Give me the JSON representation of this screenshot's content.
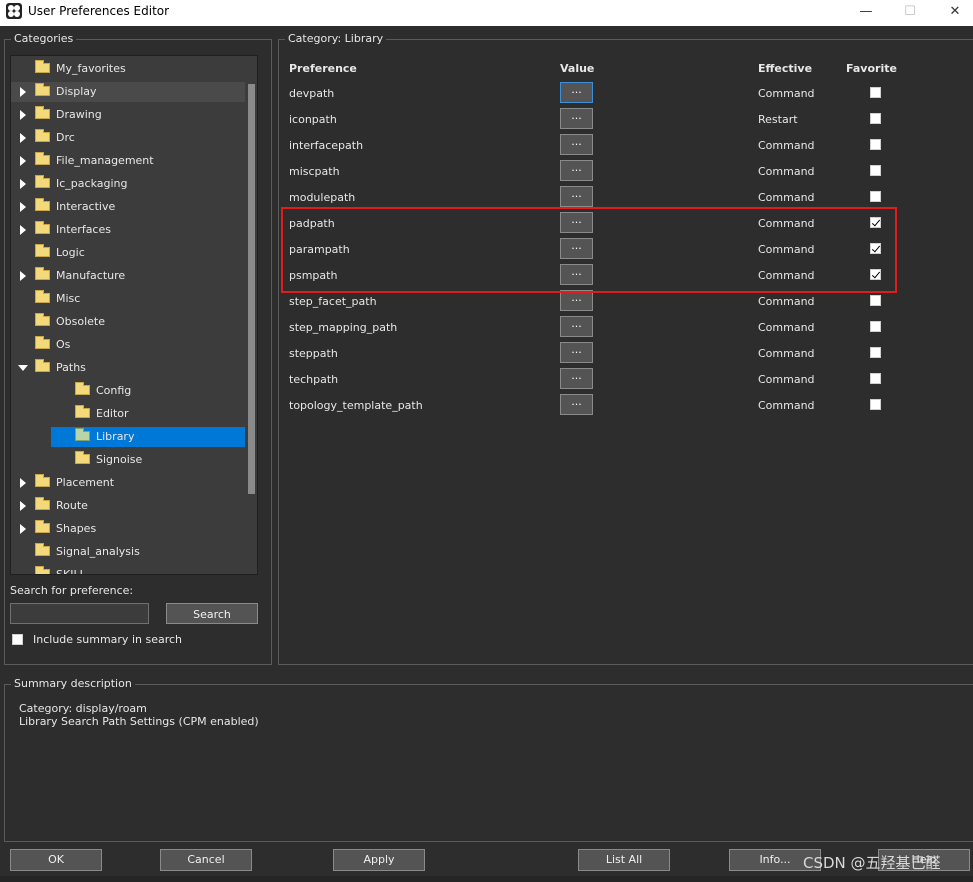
{
  "window": {
    "title": "User Preferences Editor",
    "minimize": "—",
    "maximize": "☐",
    "close": "✕"
  },
  "categories": {
    "legend": "Categories",
    "items": [
      {
        "label": "My_favorites",
        "expander": "none"
      },
      {
        "label": "Display",
        "expander": "collapsed"
      },
      {
        "label": "Drawing",
        "expander": "collapsed"
      },
      {
        "label": "Drc",
        "expander": "collapsed"
      },
      {
        "label": "File_management",
        "expander": "collapsed"
      },
      {
        "label": "Ic_packaging",
        "expander": "collapsed"
      },
      {
        "label": "Interactive",
        "expander": "collapsed"
      },
      {
        "label": "Interfaces",
        "expander": "collapsed"
      },
      {
        "label": "Logic",
        "expander": "none"
      },
      {
        "label": "Manufacture",
        "expander": "collapsed"
      },
      {
        "label": "Misc",
        "expander": "none"
      },
      {
        "label": "Obsolete",
        "expander": "none"
      },
      {
        "label": "Os",
        "expander": "none"
      },
      {
        "label": "Paths",
        "expander": "expanded"
      },
      {
        "label": "Config",
        "expander": "child"
      },
      {
        "label": "Editor",
        "expander": "child"
      },
      {
        "label": "Library",
        "expander": "child",
        "selected": true
      },
      {
        "label": "Signoise",
        "expander": "child"
      },
      {
        "label": "Placement",
        "expander": "collapsed"
      },
      {
        "label": "Route",
        "expander": "collapsed"
      },
      {
        "label": "Shapes",
        "expander": "collapsed"
      },
      {
        "label": "Signal_analysis",
        "expander": "none"
      },
      {
        "label": "SKILL",
        "expander": "none"
      }
    ]
  },
  "search": {
    "label": "Search for preference:",
    "value": "",
    "button": "Search",
    "include_summary_label": "Include summary in search",
    "include_summary_checked": false
  },
  "category_panel": {
    "legend_prefix": "Category:",
    "legend_value": "Library",
    "headers": {
      "preference": "Preference",
      "value": "Value",
      "effective": "Effective",
      "favorite": "Favorite"
    },
    "value_button_label": "...",
    "rows": [
      {
        "name": "devpath",
        "effective": "Command",
        "favorite": false
      },
      {
        "name": "iconpath",
        "effective": "Restart",
        "favorite": false
      },
      {
        "name": "interfacepath",
        "effective": "Command",
        "favorite": false
      },
      {
        "name": "miscpath",
        "effective": "Command",
        "favorite": false
      },
      {
        "name": "modulepath",
        "effective": "Command",
        "favorite": false
      },
      {
        "name": "padpath",
        "effective": "Command",
        "favorite": true
      },
      {
        "name": "parampath",
        "effective": "Command",
        "favorite": true
      },
      {
        "name": "psmpath",
        "effective": "Command",
        "favorite": true
      },
      {
        "name": "step_facet_path",
        "effective": "Command",
        "favorite": false
      },
      {
        "name": "step_mapping_path",
        "effective": "Command",
        "favorite": false
      },
      {
        "name": "steppath",
        "effective": "Command",
        "favorite": false
      },
      {
        "name": "techpath",
        "effective": "Command",
        "favorite": false
      },
      {
        "name": "topology_template_path",
        "effective": "Command",
        "favorite": false
      }
    ]
  },
  "summary": {
    "legend": "Summary description",
    "line1": "Category: display/roam",
    "line2": "Library Search Path Settings (CPM enabled)"
  },
  "buttons": {
    "ok": "OK",
    "cancel": "Cancel",
    "apply": "Apply",
    "list_all": "List All",
    "info": "Info...",
    "help": "Help"
  },
  "watermark": "CSDN @五羟基己醛",
  "colors": {
    "background": "#2d2d2d",
    "selection": "#0078d7",
    "highlight_box": "#e21b1b"
  }
}
